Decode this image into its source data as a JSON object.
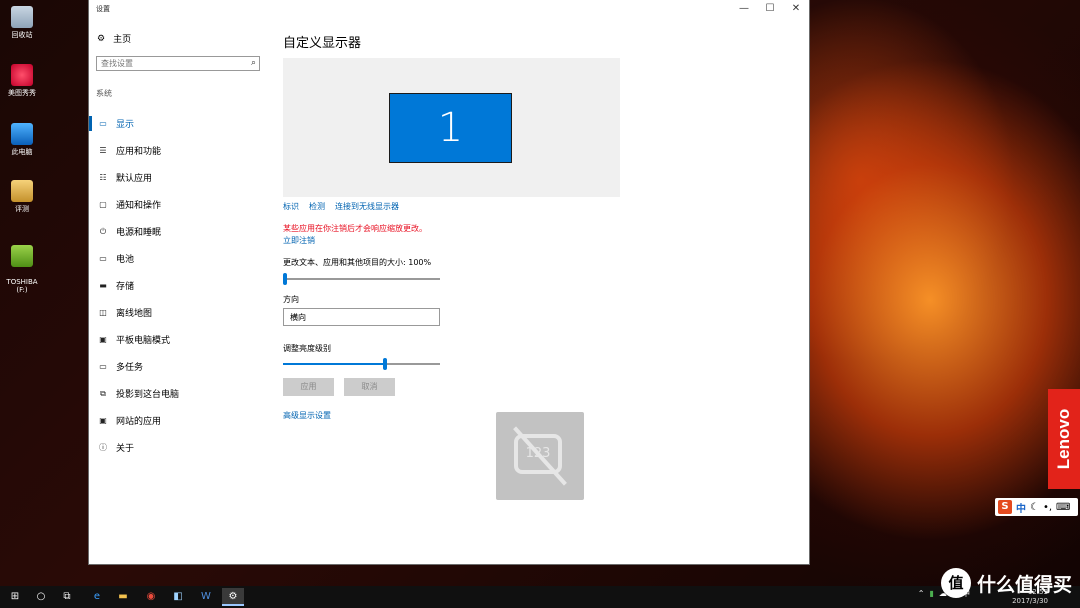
{
  "desktop": {
    "icons": [
      {
        "label": "回收站",
        "icon": "recycle-bin-icon"
      },
      {
        "label": "美图秀秀",
        "icon": "meitu-icon"
      },
      {
        "label": "此电脑",
        "icon": "this-pc-icon"
      },
      {
        "label": "评测",
        "icon": "folder-icon"
      },
      {
        "label": "TOSHIBA\n(F:)",
        "icon": "drive-icon"
      }
    ],
    "brand": "Lenovo",
    "watermark": "什么值得买",
    "watermark_badge": "值"
  },
  "window": {
    "title": "设置",
    "controls": {
      "minimize": "—",
      "maximize": "☐",
      "close": "✕"
    }
  },
  "sidebar": {
    "home_label": "主页",
    "search_placeholder": "查找设置",
    "section_label": "系统",
    "items": [
      {
        "label": "显示",
        "icon": "display-icon",
        "glyph": "▭",
        "active": true
      },
      {
        "label": "应用和功能",
        "icon": "apps-list-icon",
        "glyph": "☰"
      },
      {
        "label": "默认应用",
        "icon": "default-apps-icon",
        "glyph": "☷"
      },
      {
        "label": "通知和操作",
        "icon": "notification-icon",
        "glyph": "▢"
      },
      {
        "label": "电源和睡眠",
        "icon": "power-icon",
        "glyph": "⏻"
      },
      {
        "label": "电池",
        "icon": "battery-icon",
        "glyph": "▭"
      },
      {
        "label": "存储",
        "icon": "storage-icon",
        "glyph": "▬"
      },
      {
        "label": "离线地图",
        "icon": "map-icon",
        "glyph": "◫"
      },
      {
        "label": "平板电脑模式",
        "icon": "tablet-icon",
        "glyph": "▣"
      },
      {
        "label": "多任务",
        "icon": "multitask-icon",
        "glyph": "▭"
      },
      {
        "label": "投影到这台电脑",
        "icon": "project-icon",
        "glyph": "⧉"
      },
      {
        "label": "网站的应用",
        "icon": "web-apps-icon",
        "glyph": "▣"
      },
      {
        "label": "关于",
        "icon": "about-icon",
        "glyph": "ⓘ"
      }
    ]
  },
  "display": {
    "heading": "自定义显示器",
    "monitor_label": "1",
    "links": [
      "标识",
      "检测",
      "连接到无线显示器"
    ],
    "warning": "某些应用在你注销后才会响应缩放更改。",
    "signout_link": "立即注销",
    "scale_label": "更改文本、应用和其他项目的大小: 100%",
    "scale_level": 0,
    "orientation_label": "方向",
    "orientation_value": "横向",
    "brightness_label": "调整亮度级别",
    "brightness_level": 0.65,
    "apply_label": "应用",
    "cancel_label": "取消",
    "advanced_link": "高级显示设置",
    "overlay_text": "123"
  },
  "taskbar": {
    "clock_time": "12:53",
    "clock_date": "2017/3/30",
    "tray": [
      "⌃",
      "▮",
      "☁",
      "♪",
      "中"
    ]
  },
  "ime": {
    "logo": "S",
    "lang": "中"
  }
}
